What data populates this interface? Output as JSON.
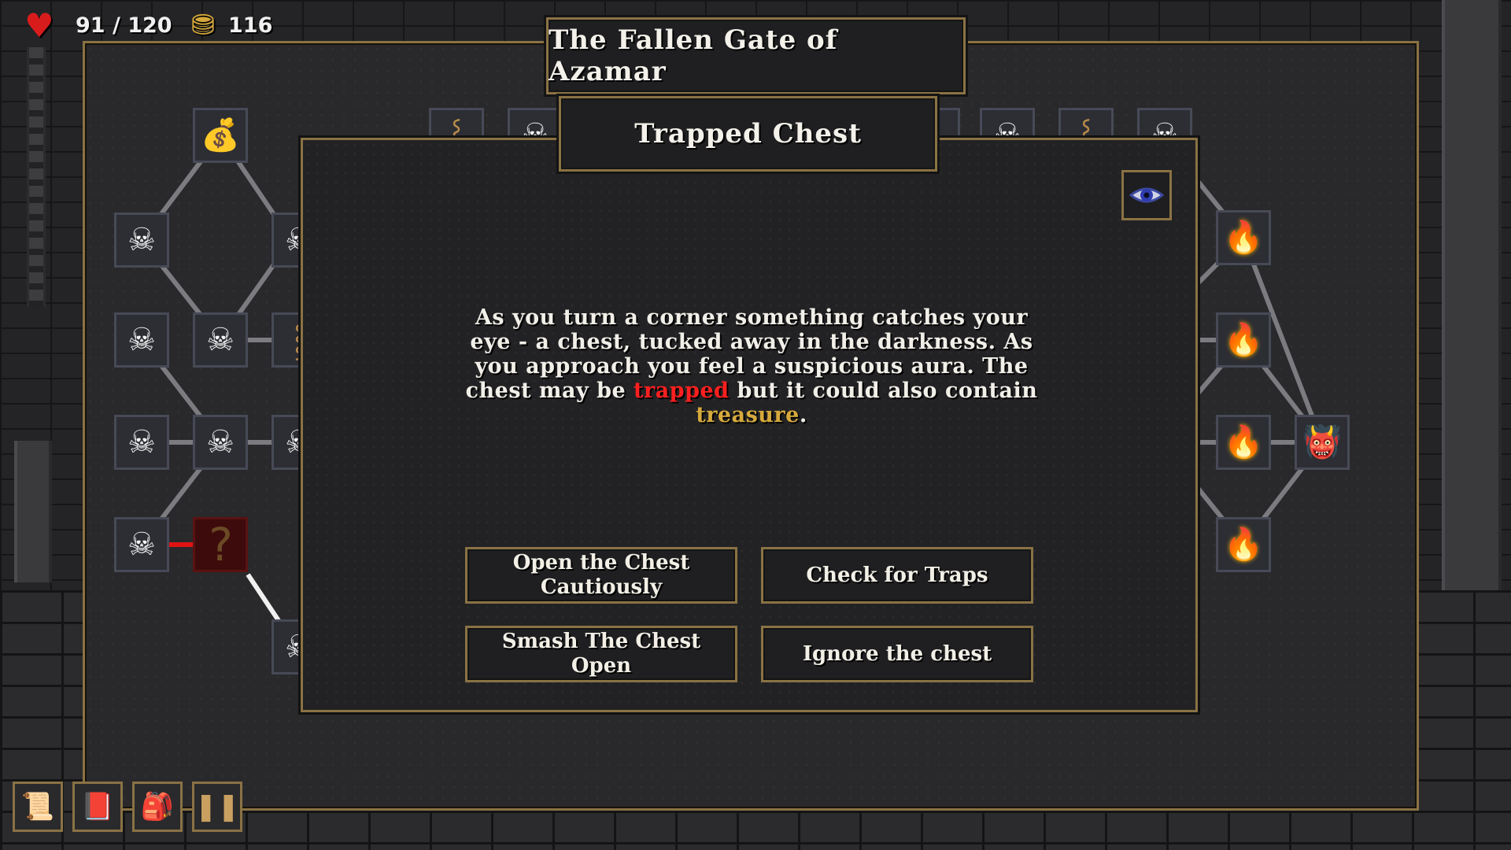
{
  "hud": {
    "hp_text": "91 / 120",
    "gold_text": "116",
    "heart_icon": "heart-icon",
    "coin_icon": "gold-coins-icon"
  },
  "map": {
    "title": "The Fallen Gate of Azamar"
  },
  "event": {
    "title": "Trapped Chest",
    "text_part1": "As you turn a corner something catches your eye - a chest, tucked away in the darkness. As you approach you feel a suspicious aura. The chest may be ",
    "keyword_trapped": "trapped",
    "text_part2": " but it could also contain ",
    "keyword_treasure": "treasure",
    "text_part3": ".",
    "choices": {
      "open": "Open the Chest Cautiously",
      "check": "Check for Traps",
      "smash": "Smash The Chest Open",
      "ignore": "Ignore the chest"
    },
    "eye_icon": "eye-icon"
  },
  "toolbar": {
    "items": [
      "scroll-icon",
      "spellbook-icon",
      "backpack-icon",
      "pause-icon"
    ]
  },
  "colors": {
    "accent_gold_border": "#8a7244",
    "keyword_red": "#ff1f1f",
    "keyword_gold": "#d6a93c"
  }
}
